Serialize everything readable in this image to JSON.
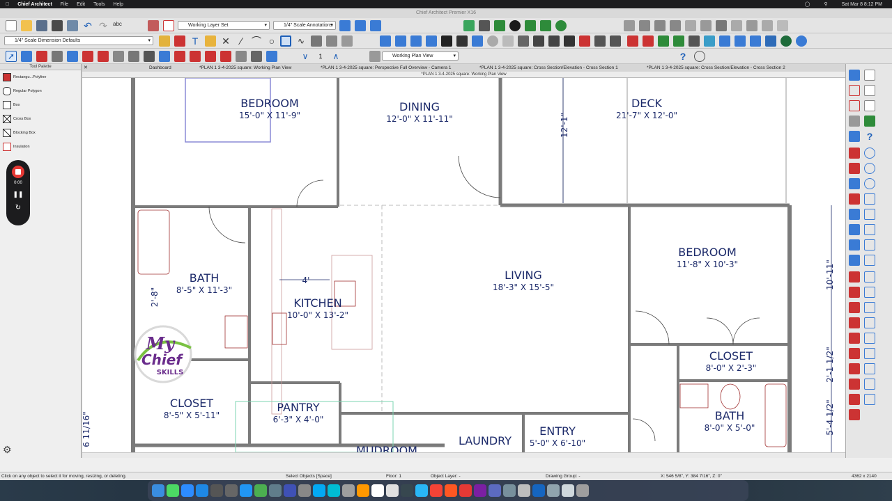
{
  "menubar": {
    "app_name": "Chief Architect",
    "menus": [
      "File",
      "Edit",
      "Tools",
      "Help"
    ],
    "clock": "Sat Mar 8  8:12 PM"
  },
  "window": {
    "title": "Chief Architect Premier X16"
  },
  "toolbar": {
    "layer_set": "Working Layer Set",
    "annotation_set": "1/4\" Scale Annotations",
    "dimension_defaults": "1/4\" Scale Dimension Defaults",
    "view_select": "Working Plan View",
    "floor_counter": "1",
    "spell_label": "abc"
  },
  "tabs": [
    {
      "label": "Dashboard"
    },
    {
      "label": "*PLAN 1 3-4-2025 square:  Working Plan View"
    },
    {
      "label": "*PLAN 1 3-4-2025 square: Perspective Full Overview - Camera 1"
    },
    {
      "label": "*PLAN 1 3-4-2025 square: Cross Section/Elevation - Cross Section 1"
    },
    {
      "label": "*PLAN 1 3-4-2025 square: Cross Section/Elevation - Cross Section 2"
    }
  ],
  "view_title": "*PLAN 1 3-4-2025 square:  Working Plan View",
  "palette": {
    "title": "Tool Palette",
    "items": [
      {
        "label": "Rectangu...Polyline",
        "icon": "rectangle-polyline-icon"
      },
      {
        "label": "Regular Polygon",
        "icon": "polygon-icon"
      },
      {
        "label": "Box",
        "icon": "box-icon"
      },
      {
        "label": "Cross Box",
        "icon": "cross-box-icon"
      },
      {
        "label": "Blocking Box",
        "icon": "blocking-box-icon"
      },
      {
        "label": "Insulation",
        "icon": "insulation-icon"
      }
    ]
  },
  "recorder": {
    "time": "0:00"
  },
  "rooms": [
    {
      "name": "BEDROOM",
      "size": "15'-0\" X 11'-9\""
    },
    {
      "name": "DINING",
      "size": "12'-0\" X 11'-11\""
    },
    {
      "name": "DECK",
      "size": "21'-7\" X 12'-0\""
    },
    {
      "name": "BEDROOM",
      "size": "11'-8\" X 10'-3\""
    },
    {
      "name": "BATH",
      "size": "8'-5\" X 11'-3\""
    },
    {
      "name": "LIVING",
      "size": "18'-3\" X 15'-5\""
    },
    {
      "name": "KITCHEN",
      "size": "10'-0\" X 13'-2\""
    },
    {
      "name": "CLOSET",
      "size": "8'-0\" X 2'-3\""
    },
    {
      "name": "CLOSET",
      "size": "8'-5\" X 5'-11\""
    },
    {
      "name": "PANTRY",
      "size": "6'-3\" X 4'-0\""
    },
    {
      "name": "BATH",
      "size": "8'-0\" X 5'-0\""
    },
    {
      "name": "MUDROOM",
      "size": ""
    },
    {
      "name": "LAUNDRY",
      "size": ""
    },
    {
      "name": "ENTRY",
      "size": "5'-0\" X 6'-10\""
    }
  ],
  "dimensions": {
    "deck_height": "12'-1\"",
    "kitchen_aisle": "4'",
    "bath_side": "2'-8\"",
    "right_upper": "10'-11\"",
    "right_mid": "2'-1 1/2\"",
    "right_lower": "5'-4 1/2\"",
    "left_lower": "6 11/16\""
  },
  "logo": {
    "line1": "My",
    "line2": "Chief",
    "line3": "SKILLS"
  },
  "status": {
    "hint": "Click on any object to select it for moving, resizing, or deleting.",
    "mode": "Select Objects [Space]",
    "floor": "Floor: 1",
    "layer": "Object Layer: -",
    "group": "Drawing Group: -",
    "coords": "X: 546 5/8\", Y: 384 7/16\", Z: 0\"",
    "resolution": "4362 x 2140"
  },
  "colors": {
    "wall": "#808080",
    "room_text": "#1c2a6a",
    "dimension": "#1c2a6a",
    "fixture": "#a03030"
  }
}
